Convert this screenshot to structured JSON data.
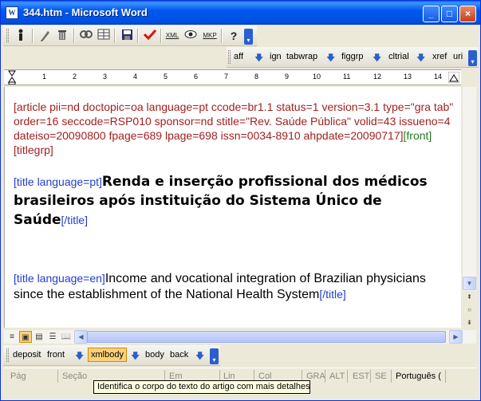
{
  "window": {
    "title": "344.htm - Microsoft Word",
    "app_icon": "W"
  },
  "title_buttons": {
    "minimize": "_",
    "maximize": "□",
    "close": "×"
  },
  "toolbar1": {
    "tools": [
      "person-icon",
      "pencil-icon",
      "trash-icon",
      "links-icon",
      "table-icon",
      "save-icon",
      "checkmark-icon",
      "xml-icon",
      "eye-icon",
      "mkp-icon",
      "help-icon"
    ],
    "labels": {
      "xml": "XML",
      "mkp": "MKP",
      "help": "?"
    }
  },
  "toolbar2": {
    "items": [
      {
        "label": "aff"
      },
      {
        "label": "ign"
      },
      {
        "label": "tabwrap"
      },
      {
        "label": "figgrp"
      },
      {
        "label": "cltrial"
      },
      {
        "label": "xref"
      },
      {
        "label": "uri"
      }
    ]
  },
  "ruler": {
    "numbers": [
      "1",
      "2",
      "3",
      "4",
      "5",
      "6",
      "7",
      "8",
      "9",
      "10",
      "11",
      "12",
      "13",
      "14"
    ]
  },
  "document": {
    "article_tag": "[article pii=nd doctopic=oa language=pt ccode=br1.1 status=1 version=3.1 type=\"gra tab\" order=16 seccode=RSP010 sponsor=nd stitle=\"Rev. Saúde Pública\" volid=43 issueno=4 dateiso=20090800 fpage=689 lpage=698 issn=0034-8910 ahpdate=20090717]",
    "front_tag": "[front]",
    "titlegrp_tag": "[titlegrp]",
    "title_pt_open": "[title language=pt]",
    "title_pt_text": "Renda e inserção profissional dos médicos brasileiros após instituição do Sistema Único de Saúde",
    "title_pt_close": "[/title]",
    "title_en_open": "[title language=en]",
    "title_en_text": "Income and vocational integration of Brazilian physicians since the establishment of the National Health System",
    "title_en_close": "[/title]"
  },
  "bottom_toolbar": {
    "items": [
      {
        "label": "deposit"
      },
      {
        "label": "front"
      },
      {
        "label": "xmlbody"
      },
      {
        "label": "body"
      },
      {
        "label": "back"
      }
    ]
  },
  "statusbar": {
    "page": "Pág",
    "section": "Seção",
    "at": "Em",
    "line": "Lin",
    "col": "Col",
    "rec": "GRA",
    "alt": "ALT",
    "ext": "EST",
    "ovr": "SE",
    "language": "Português ("
  },
  "tooltip": "Identifica o corpo do texto do artigo com mais detalhes",
  "colors": {
    "accent": "#0054e3",
    "tag_red": "#a22020",
    "tag_blue": "#1f3ccf",
    "tag_green": "#1e7d1e"
  }
}
